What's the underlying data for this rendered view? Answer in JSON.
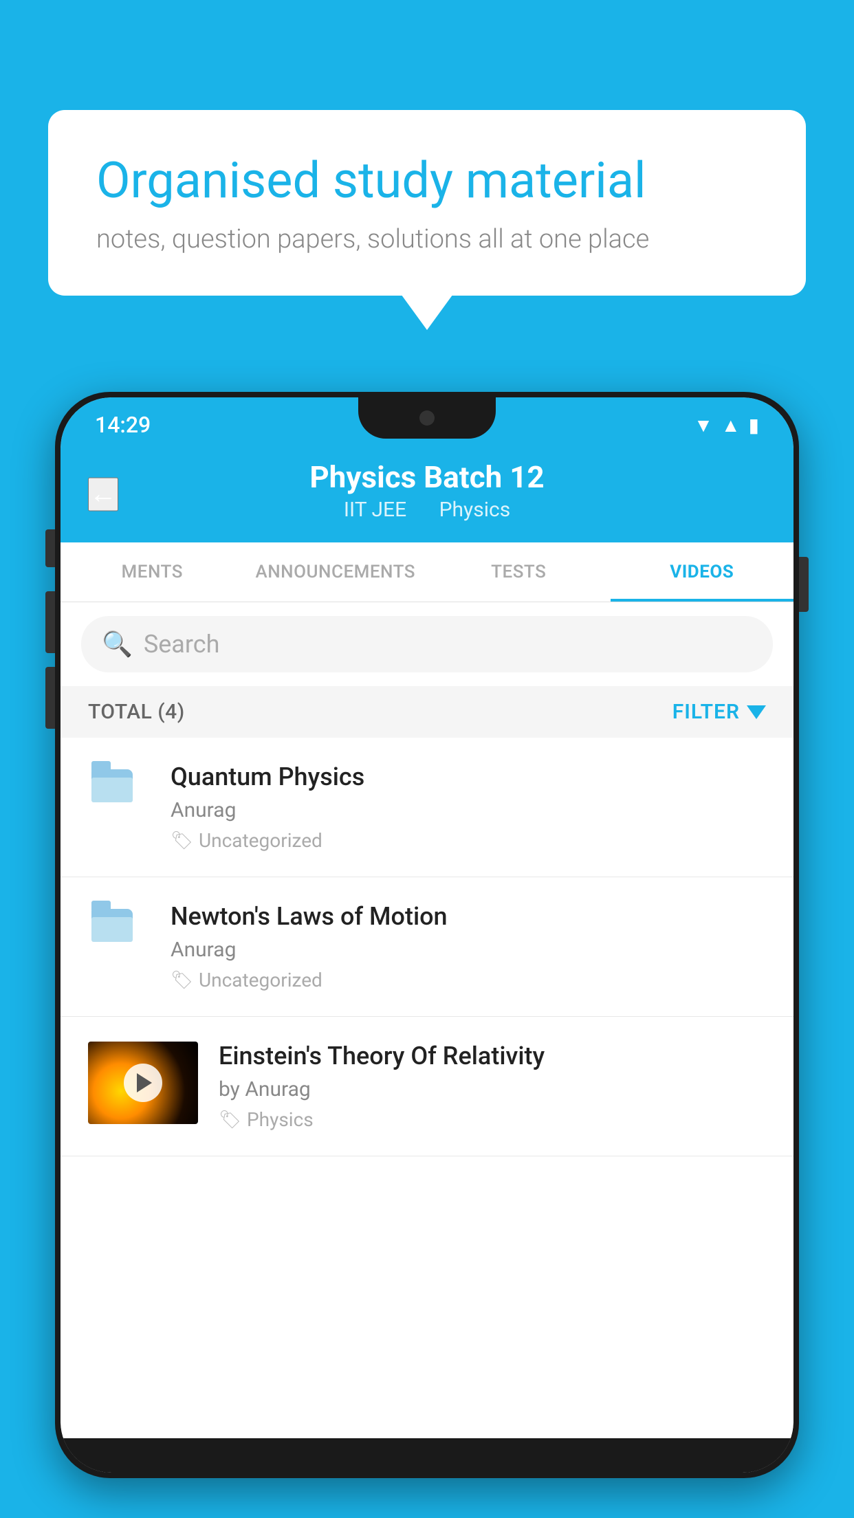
{
  "background_color": "#1ab3e8",
  "speech_bubble": {
    "title": "Organised study material",
    "subtitle": "notes, question papers, solutions all at one place"
  },
  "phone": {
    "status_bar": {
      "time": "14:29",
      "icons": [
        "wifi",
        "signal",
        "battery"
      ]
    },
    "header": {
      "back_label": "←",
      "title": "Physics Batch 12",
      "subtitle_part1": "IIT JEE",
      "subtitle_part2": "Physics"
    },
    "tabs": [
      {
        "label": "MENTS",
        "active": false
      },
      {
        "label": "ANNOUNCEMENTS",
        "active": false
      },
      {
        "label": "TESTS",
        "active": false
      },
      {
        "label": "VIDEOS",
        "active": true
      }
    ],
    "search": {
      "placeholder": "Search"
    },
    "filter_row": {
      "total_label": "TOTAL (4)",
      "filter_label": "FILTER"
    },
    "videos": [
      {
        "id": 1,
        "title": "Quantum Physics",
        "author": "Anurag",
        "tag": "Uncategorized",
        "has_thumbnail": false
      },
      {
        "id": 2,
        "title": "Newton's Laws of Motion",
        "author": "Anurag",
        "tag": "Uncategorized",
        "has_thumbnail": false
      },
      {
        "id": 3,
        "title": "Einstein's Theory Of Relativity",
        "author": "by Anurag",
        "tag": "Physics",
        "has_thumbnail": true
      }
    ]
  }
}
